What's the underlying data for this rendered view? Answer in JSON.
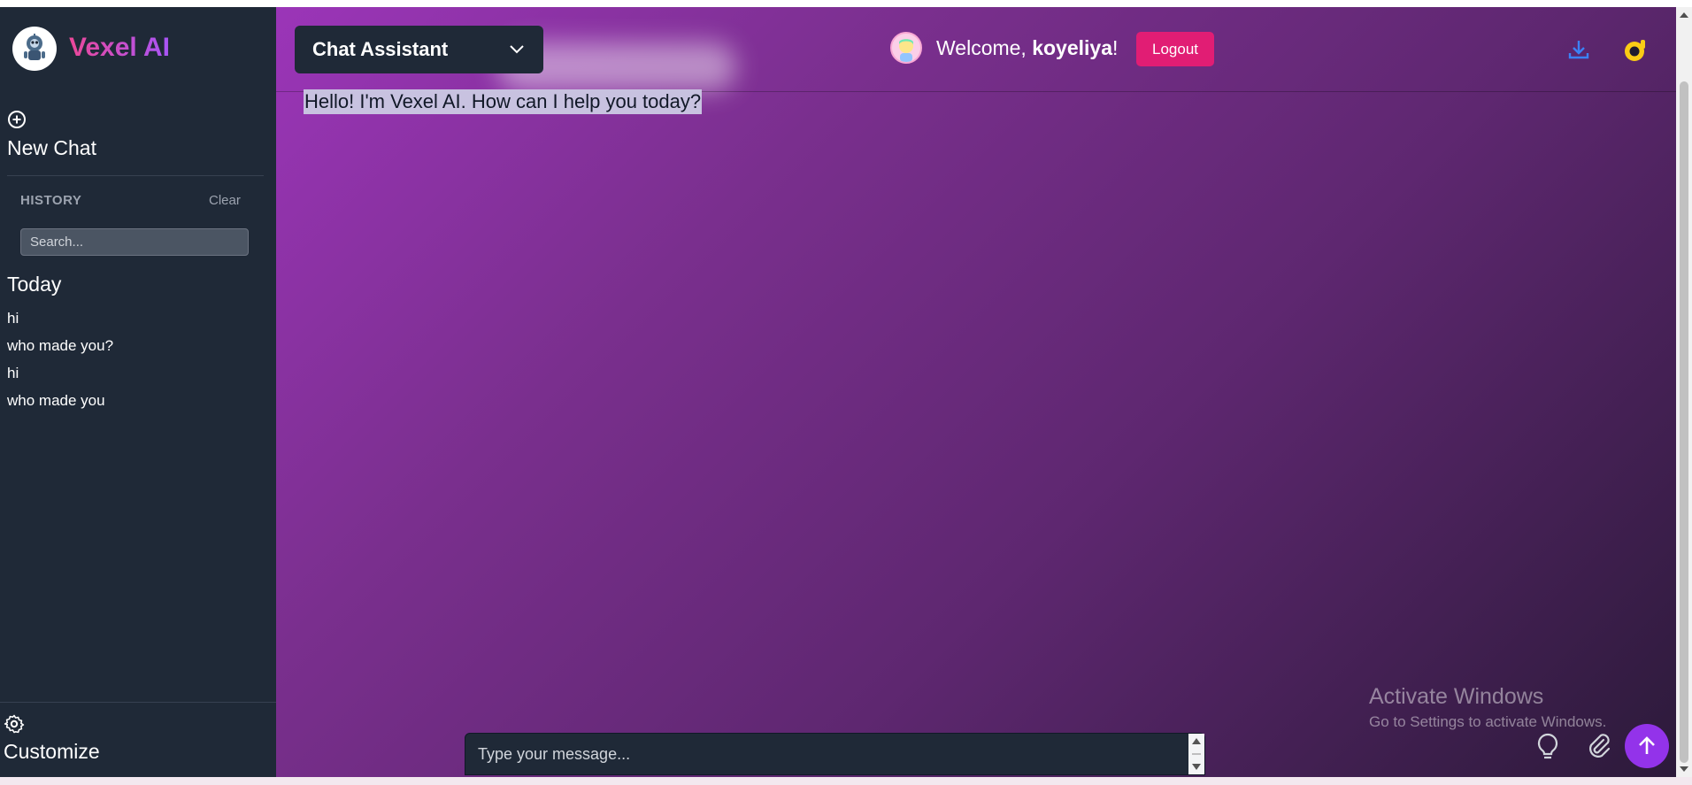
{
  "sidebar": {
    "brand": "Vexel AI",
    "new_chat_label": "New Chat",
    "history_label": "HISTORY",
    "clear_label": "Clear",
    "search_placeholder": "Search...",
    "group_label": "Today",
    "history_items": [
      "hi",
      "who made you?",
      "hi",
      "who made you"
    ],
    "customize_label": "Customize"
  },
  "header": {
    "model_label": "Chat Assistant",
    "welcome_prefix": "Welcome, ",
    "username": "koyeliya",
    "welcome_suffix": "!",
    "logout_label": "Logout"
  },
  "chat": {
    "message": "Hello! I'm Vexel AI. How can I help you today?",
    "input_placeholder": "Type your message..."
  },
  "watermark": {
    "line1": "Activate Windows",
    "line2": "Go to Settings to activate Windows."
  },
  "icons": {
    "plus": "plus-circle-icon",
    "gear": "gear-icon",
    "download": "download-icon",
    "theme": "theme-icon",
    "bulb": "lightbulb-icon",
    "clip": "paperclip-icon",
    "send": "arrow-up-icon"
  },
  "colors": {
    "sidebar_bg": "#1f2937",
    "logout_bg": "#e11d74",
    "send_bg": "#9333ea",
    "accent_yellow": "#facc15",
    "accent_blue": "#3b82f6"
  }
}
